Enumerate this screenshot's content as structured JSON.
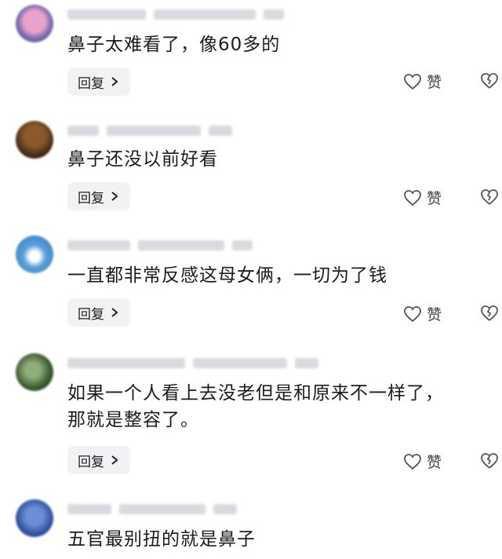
{
  "comments": [
    {
      "text": "鼻子太难看了，像60多的",
      "reply_label": "回复",
      "like_label": "赞"
    },
    {
      "text": "鼻子还没以前好看",
      "reply_label": "回复",
      "like_label": "赞"
    },
    {
      "text": "一直都非常反感这母女俩，一切为了钱",
      "reply_label": "回复",
      "like_label": "赞"
    },
    {
      "text": "如果一个人看上去没老但是和原来不一样了，\n那就是整容了。",
      "reply_label": "回复",
      "like_label": "赞"
    },
    {
      "text": "五官最别扭的就是鼻子"
    }
  ],
  "icons": {
    "like": "heart-outline-icon",
    "dislike": "broken-heart-icon",
    "reply_arrow": "chevron-right-icon"
  },
  "colors": {
    "reply_bg": "#f2f2f4",
    "text": "#1c1c1c",
    "icon": "#555555"
  }
}
